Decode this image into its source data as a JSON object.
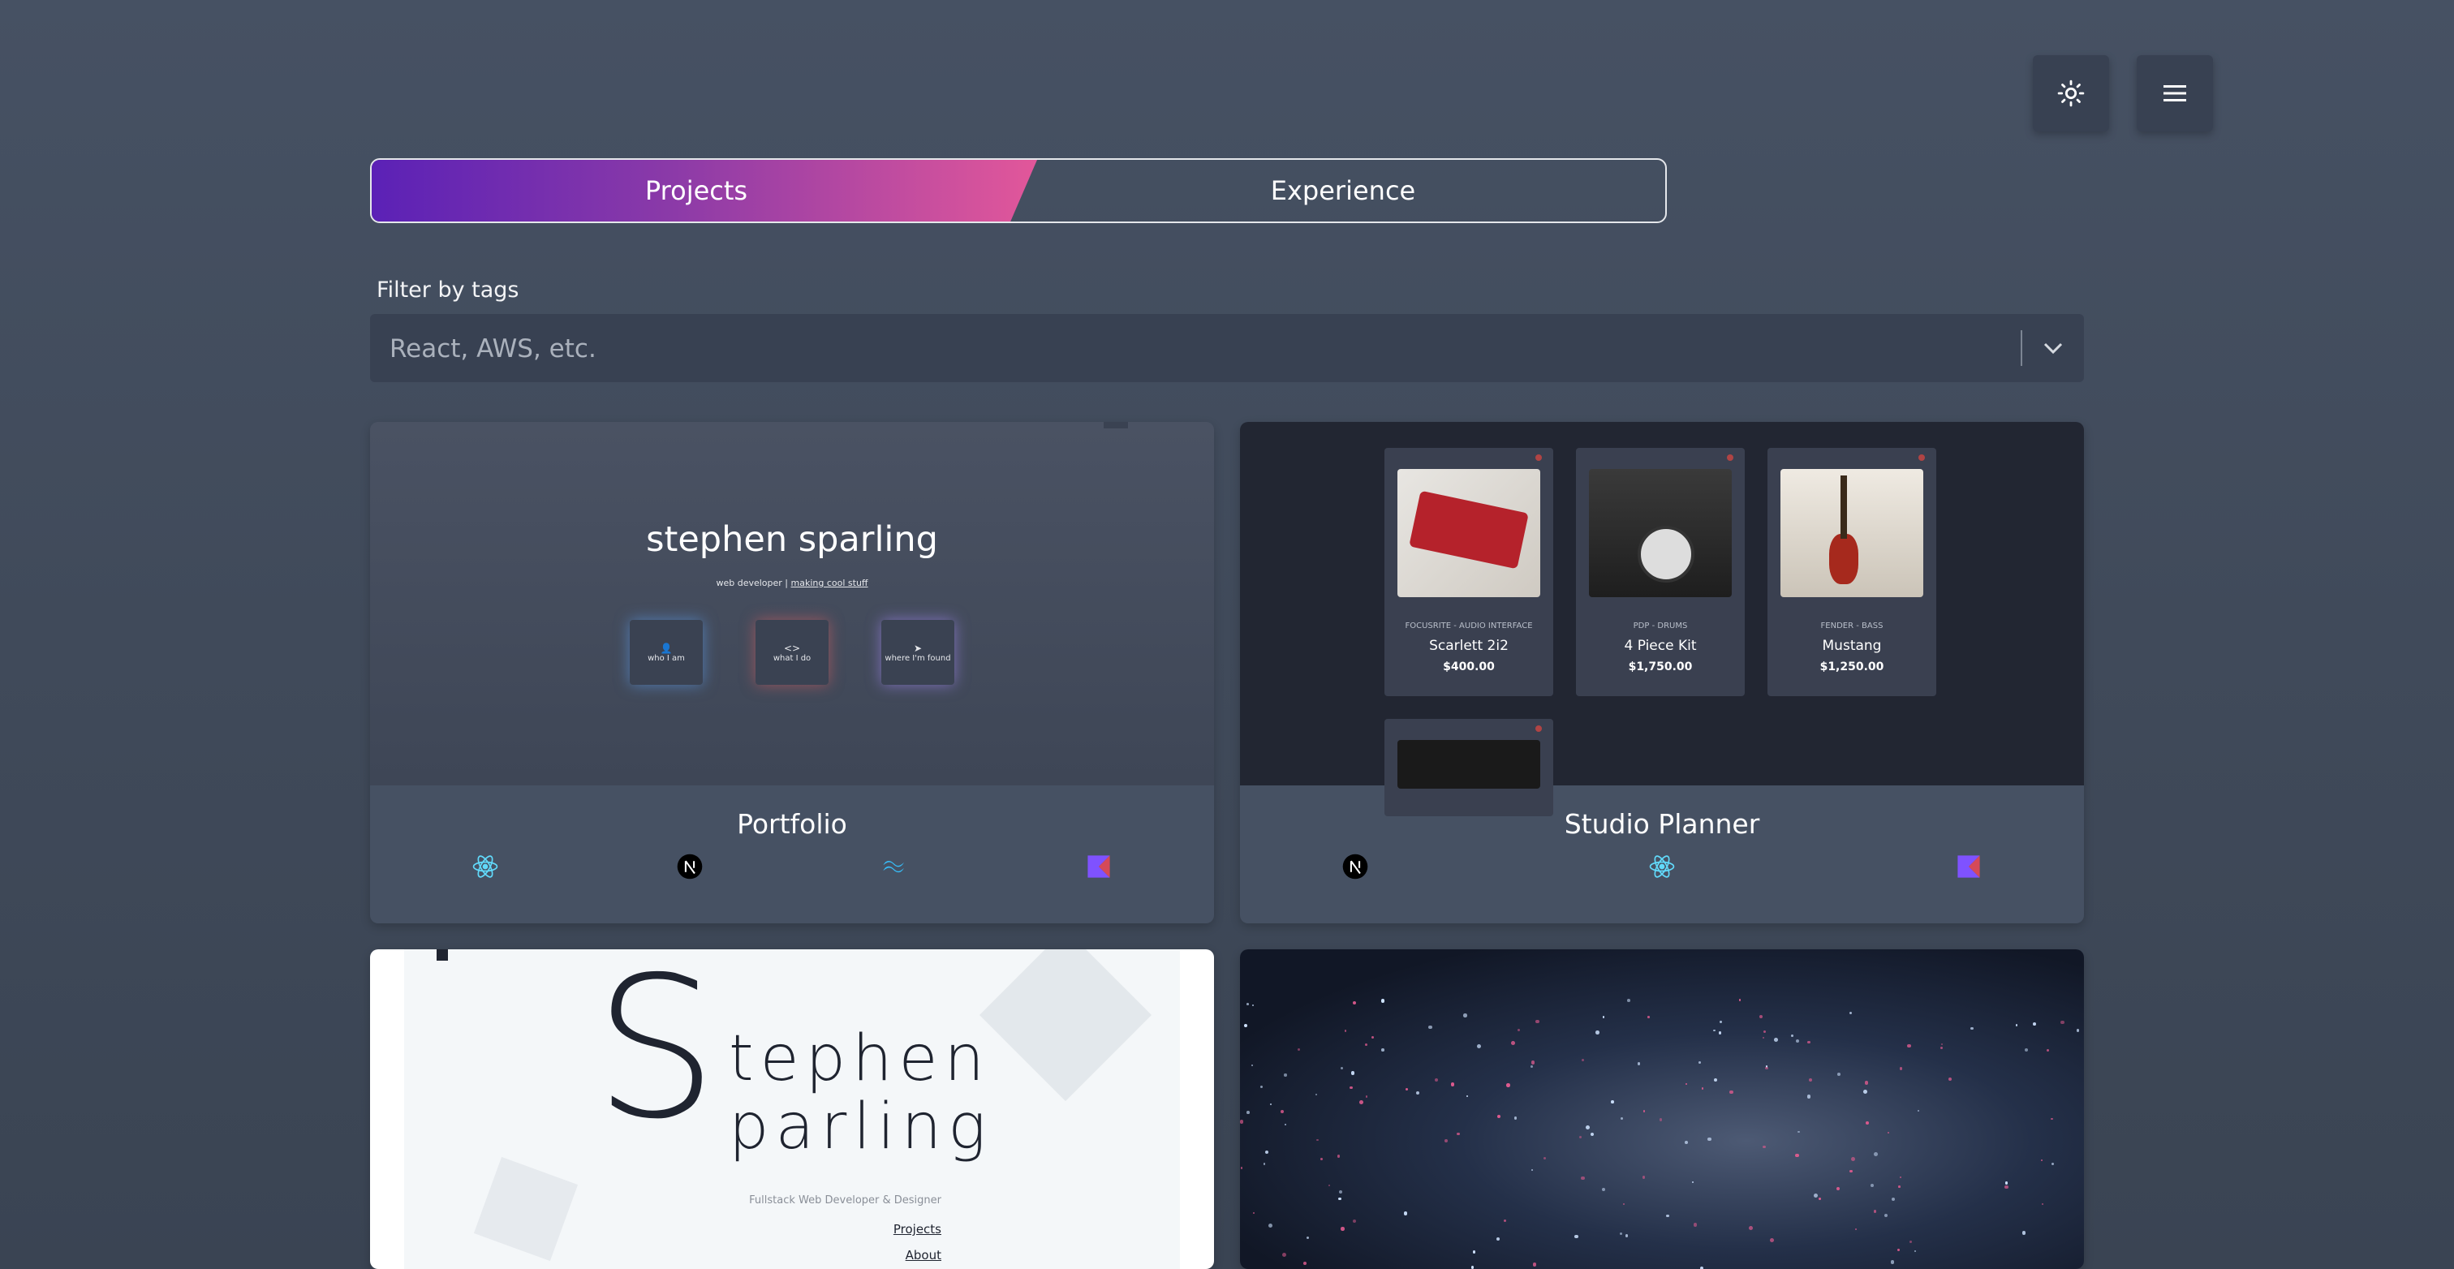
{
  "toolbar": {
    "theme_icon": "sun-icon",
    "menu_icon": "hamburger-menu-icon"
  },
  "toggle": {
    "projects_label": "Projects",
    "experience_label": "Experience",
    "active": "Projects",
    "gradient": [
      "#5b21b6",
      "#e2579a"
    ]
  },
  "filter": {
    "label": "Filter by tags",
    "placeholder": "React, AWS, etc."
  },
  "cards": [
    {
      "title": "Portfolio",
      "tags": [
        "react-icon",
        "nextjs-icon",
        "tailwind-icon",
        "kotlin-icon"
      ],
      "preview": {
        "name": "stephen sparling",
        "subtitle_prefix": "web developer | ",
        "subtitle_link": "making cool stuff",
        "boxes": [
          "who I am",
          "what I do",
          "where I'm found"
        ]
      }
    },
    {
      "title": "Studio Planner",
      "tags": [
        "nextjs-icon",
        "react-icon",
        "kotlin-icon"
      ],
      "preview": {
        "items": [
          {
            "category": "FOCUSRITE - AUDIO INTERFACE",
            "name": "Scarlett 2i2",
            "price": "$400.00"
          },
          {
            "category": "PDP - DRUMS",
            "name": "4 Piece Kit",
            "price": "$1,750.00"
          },
          {
            "category": "FENDER - BASS",
            "name": "Mustang",
            "price": "$1,250.00"
          }
        ]
      }
    },
    {
      "title": "",
      "tags": [],
      "preview": {
        "big_s": "S",
        "line1": "tephen",
        "line2": "parling",
        "subtitle": "Fullstack Web Developer & Designer",
        "links": [
          "Projects",
          "About"
        ]
      }
    },
    {
      "title": "",
      "tags": [],
      "preview": {}
    }
  ]
}
